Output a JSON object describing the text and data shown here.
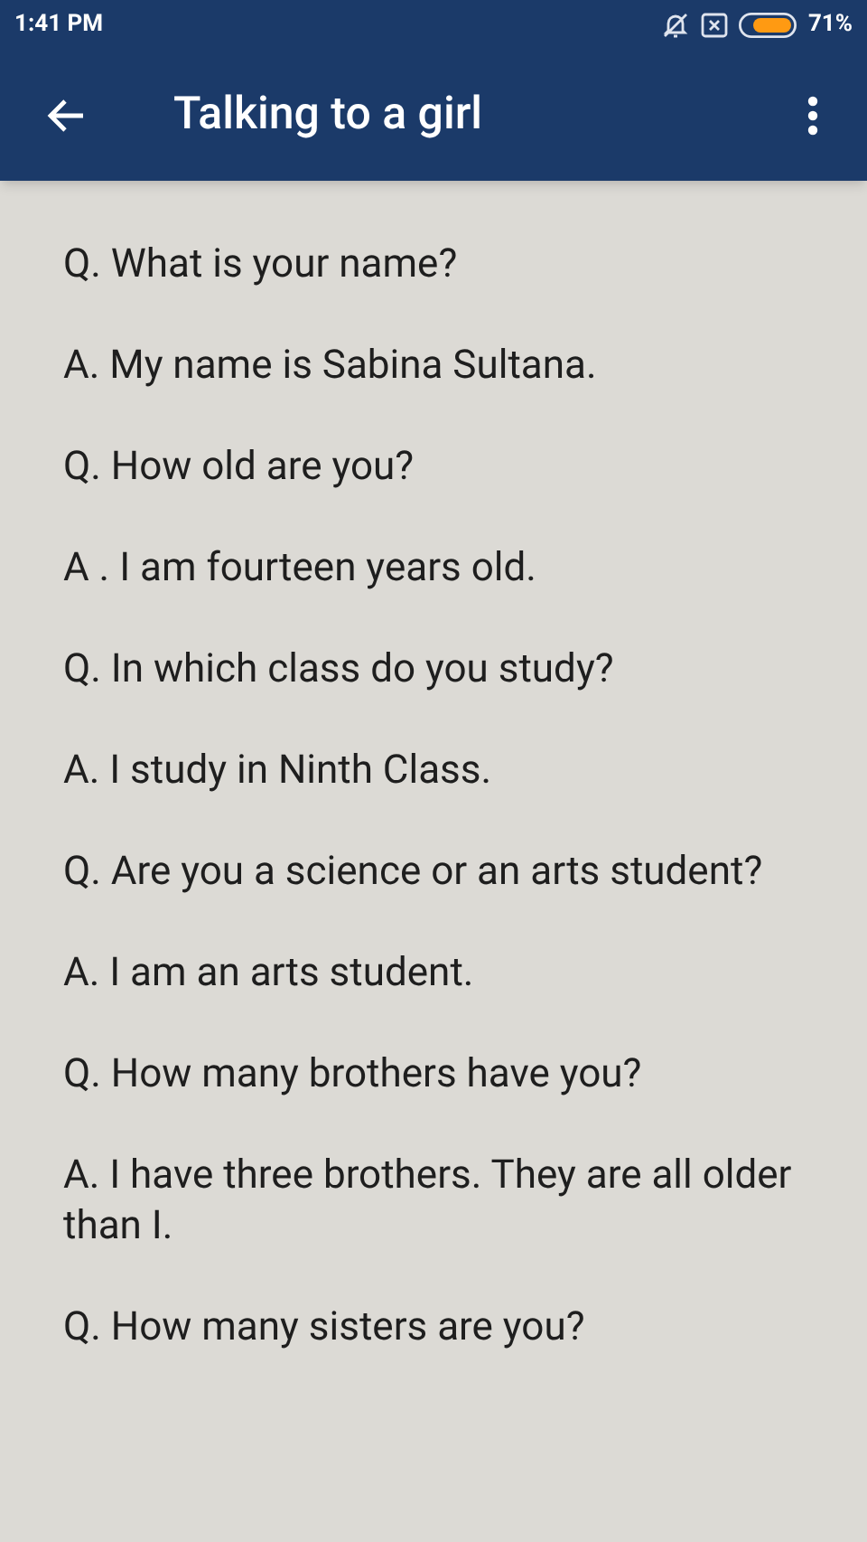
{
  "status_bar": {
    "time": "1:41 PM",
    "battery": "71%"
  },
  "app_bar": {
    "title": "Talking to a girl"
  },
  "lines": [
    "Q. What is your name?",
    "A. My name is Sabina Sultana.",
    "Q. How old are you?",
    "A . I am fourteen years old.",
    "Q. In which class do you study?",
    "A. I study in Ninth Class.",
    "Q. Are you a science or an arts student?",
    "A. I am an arts student.",
    "Q. How many brothers have you?",
    "A. I have three brothers. They are all older than I.",
    "Q. How many sisters are you?"
  ]
}
